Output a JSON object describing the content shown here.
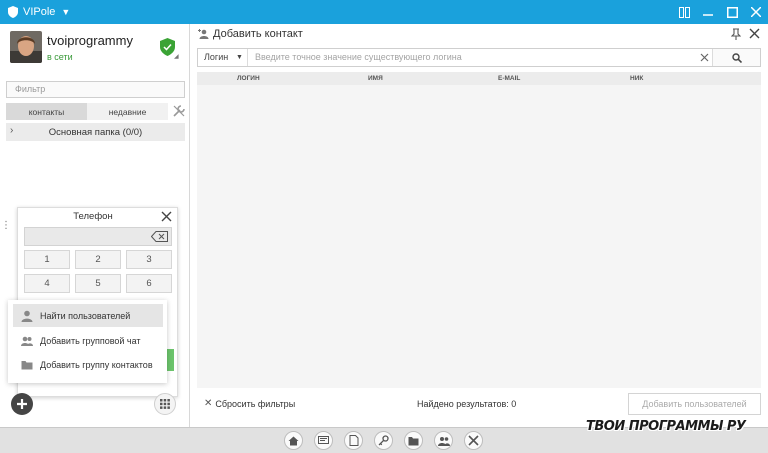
{
  "app": {
    "title": "VIPole"
  },
  "colors": {
    "titlebar": "#1aa1dc",
    "online": "#3a9a3a",
    "shield": "#3aa335"
  },
  "profile": {
    "username": "tvoiprogrammy",
    "status": "в сети"
  },
  "sidebar": {
    "filter_placeholder": "Фильтр",
    "tabs": [
      {
        "label": "контакты",
        "active": true
      },
      {
        "label": "недавние",
        "active": false
      }
    ],
    "folder_label": "Основная папка (0/0)"
  },
  "dialer": {
    "title": "Телефон",
    "keys": [
      "1",
      "2",
      "3",
      "4",
      "5",
      "6"
    ]
  },
  "menu": {
    "items": [
      {
        "label": "Найти пользователей",
        "icon": "user-icon",
        "highlighted": true
      },
      {
        "label": "Добавить групповой чат",
        "icon": "group-icon",
        "highlighted": false
      },
      {
        "label": "Добавить группу контактов",
        "icon": "folder-icon",
        "highlighted": false
      }
    ]
  },
  "main": {
    "title": "Добавить контакт",
    "search": {
      "field_select": "Логин",
      "placeholder": "Введите точное значение существующего логина"
    },
    "columns": [
      "ЛОГИН",
      "ИМЯ",
      "E-MAIL",
      "НИК"
    ],
    "reset_filters": "Сбросить фильтры",
    "results": "Найдено результатов: 0",
    "add_users_button": "Добавить пользователей"
  },
  "bottombar": {
    "icons": [
      "home-icon",
      "chat-icon",
      "file-icon",
      "key-icon",
      "folder-icon",
      "contacts-icon",
      "tools-icon"
    ]
  },
  "watermark": "ТВОИ ПРОГРАММЫ РУ"
}
